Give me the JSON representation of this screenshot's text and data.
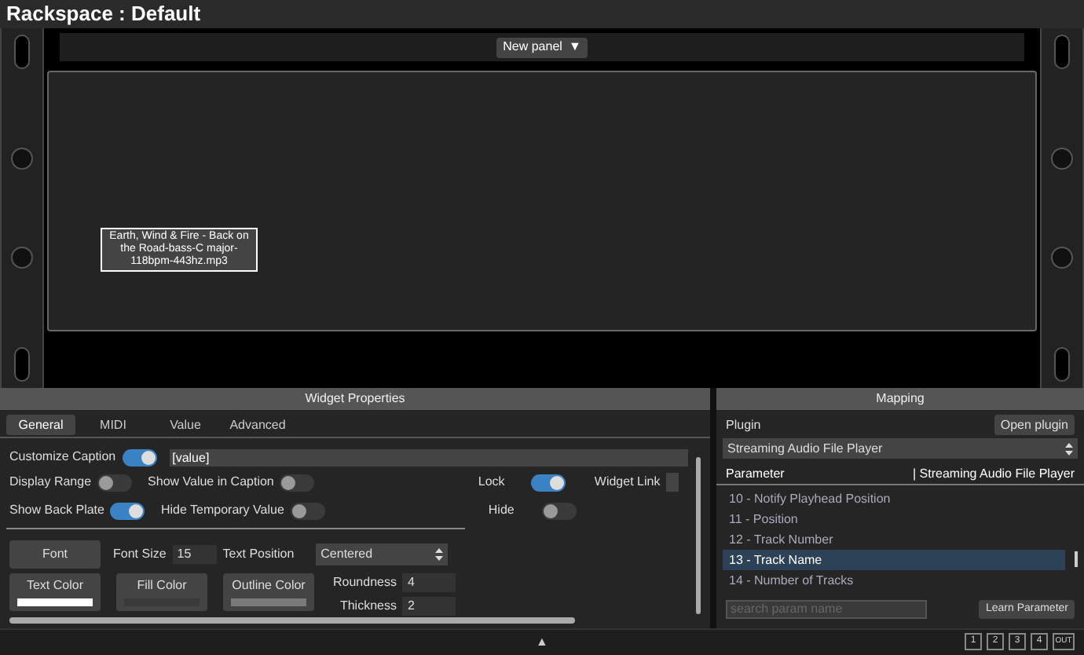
{
  "title": "Rackspace : Default",
  "rack": {
    "panel_menu": "New panel",
    "arrow": "▼",
    "widget": {
      "caption": "Earth, Wind & Fire - Back on the Road-bass-C major-118bpm-443hz.mp3",
      "selected": true
    }
  },
  "widget_properties": {
    "title": "Widget Properties",
    "tabs": [
      {
        "label": "General",
        "selected": true
      },
      {
        "label": "MIDI",
        "selected": false
      },
      {
        "label": "Value",
        "selected": false
      },
      {
        "label": "Advanced",
        "selected": false
      }
    ],
    "caption": {
      "label": "Customize Caption",
      "on": true,
      "value": "[value]"
    },
    "toggle_rows": [
      [
        {
          "label": "Display Range",
          "on": false
        },
        {
          "label": "Show Value in Caption",
          "on": false
        },
        {
          "label": "Lock",
          "on": true
        }
      ],
      [
        {
          "label": "Show Back Plate",
          "on": true
        },
        {
          "label": "Hide Temporary Value",
          "on": false
        },
        {
          "label": "Hide",
          "on": false
        }
      ]
    ],
    "widget_link": {
      "label": "Widget Link"
    },
    "font_button": "Font",
    "font_size": {
      "label": "Font Size",
      "value": "15"
    },
    "text_position": {
      "label": "Text Position",
      "value": "Centered"
    },
    "color_buttons": [
      {
        "label": "Text Color",
        "color": "#ffffff"
      },
      {
        "label": "Fill Color",
        "color": "#3a3a3a"
      },
      {
        "label": "Outline Color",
        "color": "#7a7a7a"
      }
    ],
    "roundness": {
      "label": "Roundness",
      "value": "4"
    },
    "thickness": {
      "label": "Thickness",
      "value": "2"
    }
  },
  "mapping": {
    "title": "Mapping",
    "plugin_label": "Plugin",
    "open_button": "Open plugin",
    "plugin_select": "Streaming Audio File Player",
    "columns": [
      "Parameter",
      "| Streaming Audio File Player"
    ],
    "params": [
      {
        "label": "10 - Notify Playhead Position",
        "selected": false
      },
      {
        "label": "11 - Position",
        "selected": false
      },
      {
        "label": "12 - Track Number",
        "selected": false
      },
      {
        "label": "13 - Track Name",
        "selected": true
      },
      {
        "label": "14 - Number of Tracks",
        "selected": false
      }
    ],
    "search": {
      "placeholder": "search param name"
    },
    "learn_button": "Learn Parameter"
  },
  "footer": {
    "collapse": "▲",
    "pages": [
      "1",
      "2",
      "3",
      "4"
    ],
    "out": "OUT"
  }
}
